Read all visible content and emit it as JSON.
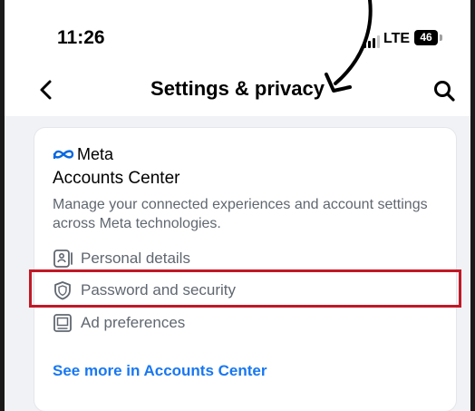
{
  "status_bar": {
    "time": "11:26",
    "network": "LTE",
    "battery": "46"
  },
  "nav": {
    "title": "Settings & privacy",
    "back_icon": "chevron-left-icon",
    "search_icon": "search-icon"
  },
  "accounts_card": {
    "brand": "Meta",
    "title": "Accounts Center",
    "description": "Manage your connected experiences and account settings across Meta technologies.",
    "items": [
      {
        "label": "Personal details",
        "icon": "id-card-icon"
      },
      {
        "label": "Password and security",
        "icon": "shield-icon"
      },
      {
        "label": "Ad preferences",
        "icon": "monitor-icon"
      }
    ],
    "see_more": "See more in Accounts Center"
  },
  "colors": {
    "link": "#1877f2",
    "highlight": "#c21826",
    "secondary_text": "#606770"
  }
}
